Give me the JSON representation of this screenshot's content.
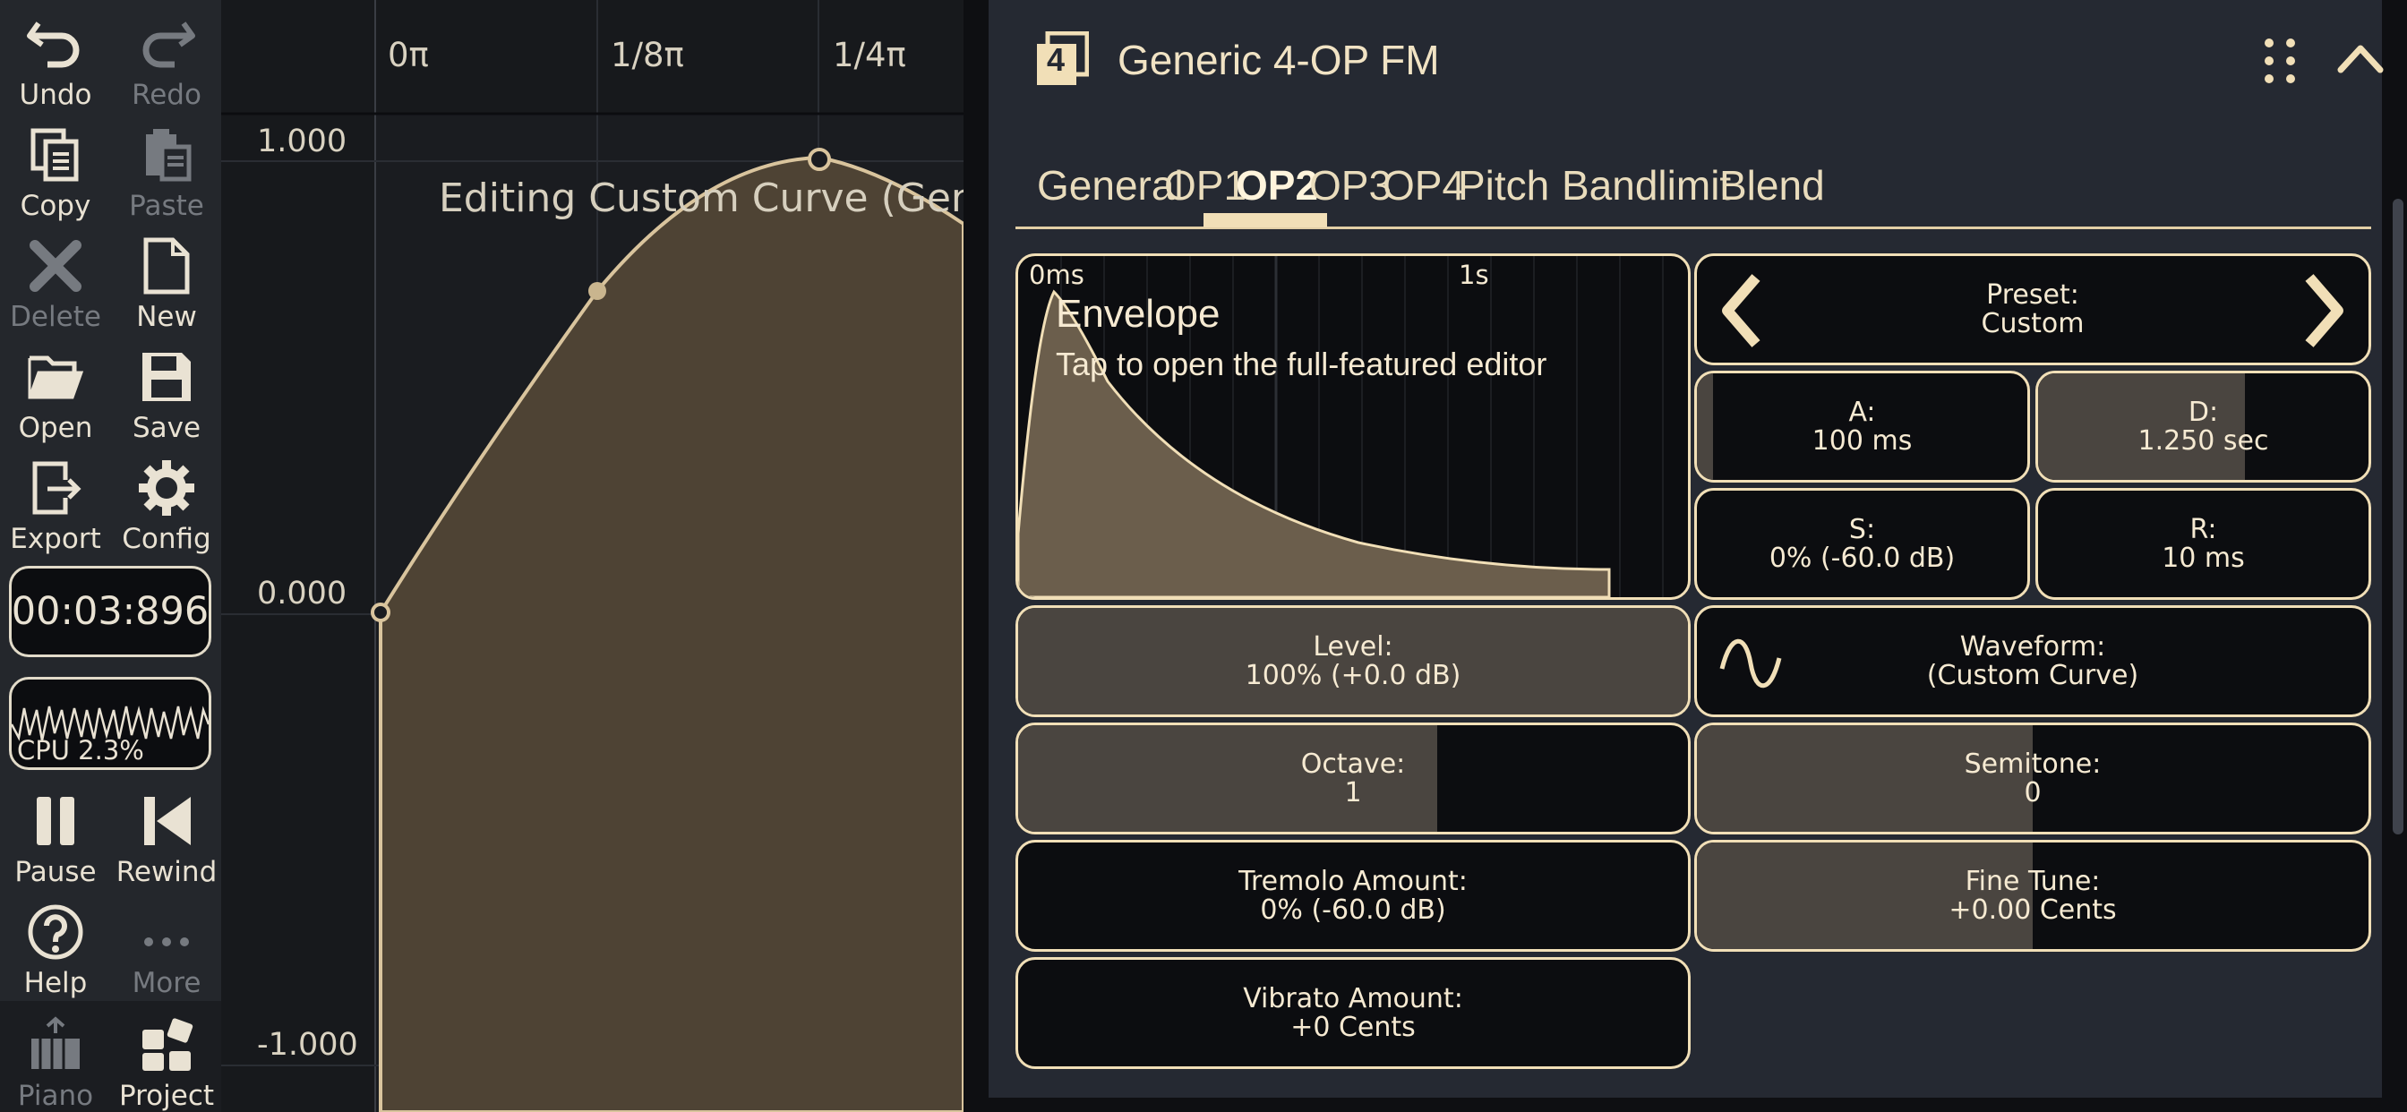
{
  "toolbar": {
    "undo": "Undo",
    "redo": "Redo",
    "copy": "Copy",
    "paste": "Paste",
    "delete": "Delete",
    "new": "New",
    "open": "Open",
    "save": "Save",
    "export": "Export",
    "config": "Config",
    "pause": "Pause",
    "rewind": "Rewind",
    "help": "Help",
    "more": "More",
    "piano": "Piano",
    "project": "Project",
    "timer": "00:03:896",
    "cpu": "CPU 2.3%"
  },
  "curve_editor": {
    "x_ticks": [
      "0π",
      "1/8π",
      "1/4π"
    ],
    "y_ticks": [
      "1.000",
      "0.000",
      "-1.000"
    ],
    "title": "Editing Custom Curve (Gene"
  },
  "panel": {
    "badge_number": "4",
    "title": "Generic 4-OP FM",
    "tabs": [
      "General",
      "OP1",
      "OP2",
      "OP3",
      "OP4",
      "Pitch",
      "Bandlimit",
      "Blend"
    ],
    "active_tab": "OP2",
    "envelope": {
      "tick_start": "0ms",
      "tick_mid": "1s",
      "title": "Envelope",
      "subtitle": "Tap to open the full-featured editor"
    },
    "preset": {
      "label": "Preset:",
      "value": "Custom"
    },
    "attack": {
      "label": "A:",
      "value": "100 ms",
      "level": 0.05
    },
    "decay": {
      "label": "D:",
      "value": "1.250 sec",
      "level": 0.625
    },
    "sustain": {
      "label": "S:",
      "value": "0% (-60.0 dB)"
    },
    "release": {
      "label": "R:",
      "value": "10 ms"
    },
    "level": {
      "label": "Level:",
      "value": "100% (+0.0 dB)",
      "level": 1.0
    },
    "waveform": {
      "label": "Waveform:",
      "value": "(Custom Curve)"
    },
    "octave": {
      "label": "Octave:",
      "value": "1",
      "level": 0.625
    },
    "semitone": {
      "label": "Semitone:",
      "value": "0",
      "level": 0.5
    },
    "tremolo": {
      "label": "Tremolo Amount:",
      "value": "0% (-60.0 dB)"
    },
    "fine_tune": {
      "label": "Fine Tune:",
      "value": "+0.00 Cents",
      "level": 0.5
    },
    "vibrato": {
      "label": "Vibrato Amount:",
      "value": "+0 Cents"
    }
  },
  "colors": {
    "accent": "#f1dfb7",
    "panel_bg": "#252932",
    "fill": "#4a4540",
    "curve_fill": "#4e4334"
  }
}
